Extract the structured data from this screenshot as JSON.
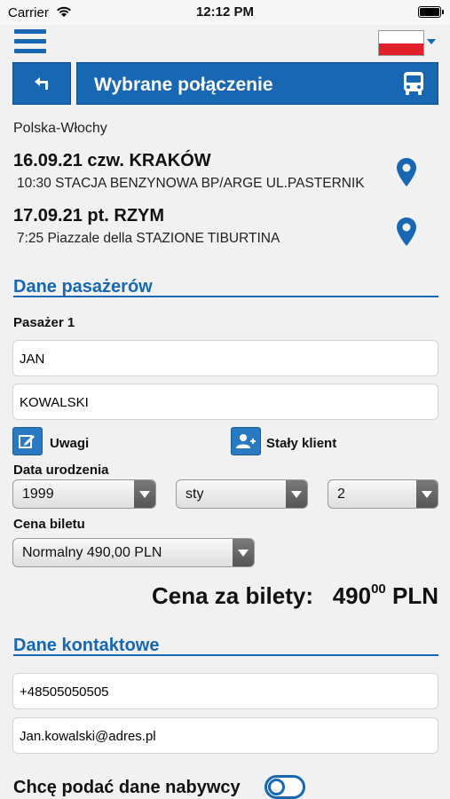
{
  "status_bar": {
    "carrier": "Carrier",
    "time": "12:12 PM"
  },
  "header": {
    "title": "Wybrane połączenie",
    "language_flag": "poland-flag"
  },
  "route": {
    "name": "Polska-Włochy",
    "departure": {
      "date_city": "16.09.21 czw. KRAKÓW",
      "time_place": "10:30 STACJA BENZYNOWA BP/ARGE UL.PASTERNIK"
    },
    "arrival": {
      "date_city": "17.09.21 pt. RZYM",
      "time_place": "7:25 Piazzale della STAZIONE TIBURTINA"
    }
  },
  "passengers": {
    "section_title": "Dane pasażerów",
    "passenger_label": "Pasażer 1",
    "first_name": "JAN",
    "last_name": "KOWALSKI",
    "notes_label": "Uwagi",
    "loyal_client_label": "Stały klient",
    "birth_date_label": "Data urodzenia",
    "birth_year": "1999",
    "birth_month": "sty",
    "birth_day": "2",
    "ticket_price_label": "Cena biletu",
    "ticket_type": "Normalny 490,00 PLN"
  },
  "total": {
    "label": "Cena za bilety:",
    "amount_main": "490",
    "amount_cents": "00",
    "currency": "PLN"
  },
  "contact": {
    "section_title": "Dane kontaktowe",
    "phone": "+48505050505",
    "email": "Jan.kowalski@adres.pl"
  },
  "buyer": {
    "label": "Chcę podać dane nabywcy",
    "enabled": false
  },
  "colors": {
    "accent": "#1767b3",
    "flag_red": "#e0202b"
  }
}
